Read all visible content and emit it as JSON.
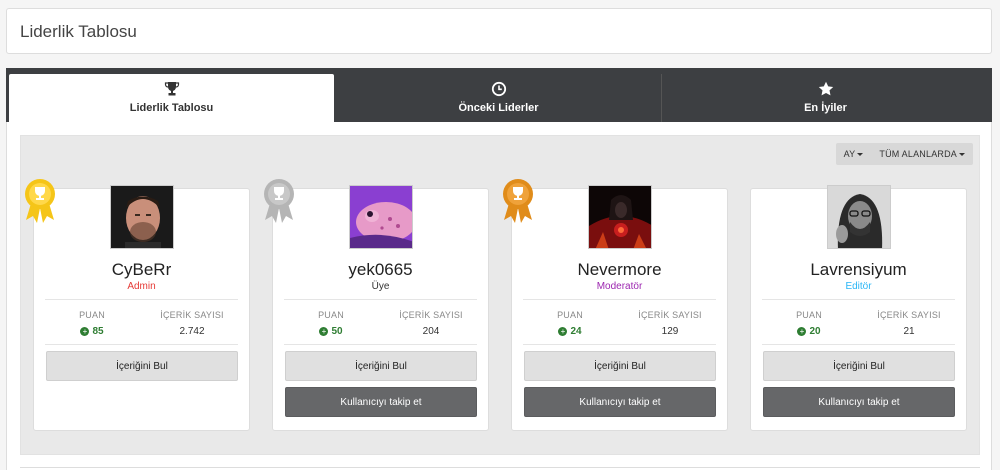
{
  "page": {
    "title": "Liderlik Tablosu"
  },
  "tabs": [
    {
      "label": "Liderlik Tablosu",
      "icon": "trophy-icon",
      "active": true
    },
    {
      "label": "Önceki Liderler",
      "icon": "clock-icon",
      "active": false
    },
    {
      "label": "En İyiler",
      "icon": "star-icon",
      "active": false
    }
  ],
  "filters": {
    "period": "AY",
    "scope": "TÜM ALANLARDA"
  },
  "stats_labels": {
    "points": "PUAN",
    "content": "İÇERİK SAYISI"
  },
  "buttons": {
    "find_content": "İçeriğini Bul",
    "follow": "Kullanıcıyı takip et"
  },
  "colors": {
    "gold": "#f5c518",
    "silver": "#b5b5b5",
    "bronze": "#e08c1a",
    "admin": "#e53935",
    "moderator": "#9c27b0",
    "editor": "#29b6f6",
    "points": "#2e7d32",
    "tabbar": "#3d3f42"
  },
  "leaders": [
    {
      "name": "CyBeRr",
      "role": "Admin",
      "points": "85",
      "content_count": "2.742",
      "medal": "gold",
      "has_follow": false
    },
    {
      "name": "yek0665",
      "role": "Üye",
      "points": "50",
      "content_count": "204",
      "medal": "silver",
      "has_follow": true
    },
    {
      "name": "Nevermore",
      "role": "Moderatör",
      "points": "24",
      "content_count": "129",
      "medal": "bronze",
      "has_follow": true
    },
    {
      "name": "Lavrensiyum",
      "role": "Editör",
      "points": "20",
      "content_count": "21",
      "medal": "",
      "has_follow": true
    }
  ]
}
